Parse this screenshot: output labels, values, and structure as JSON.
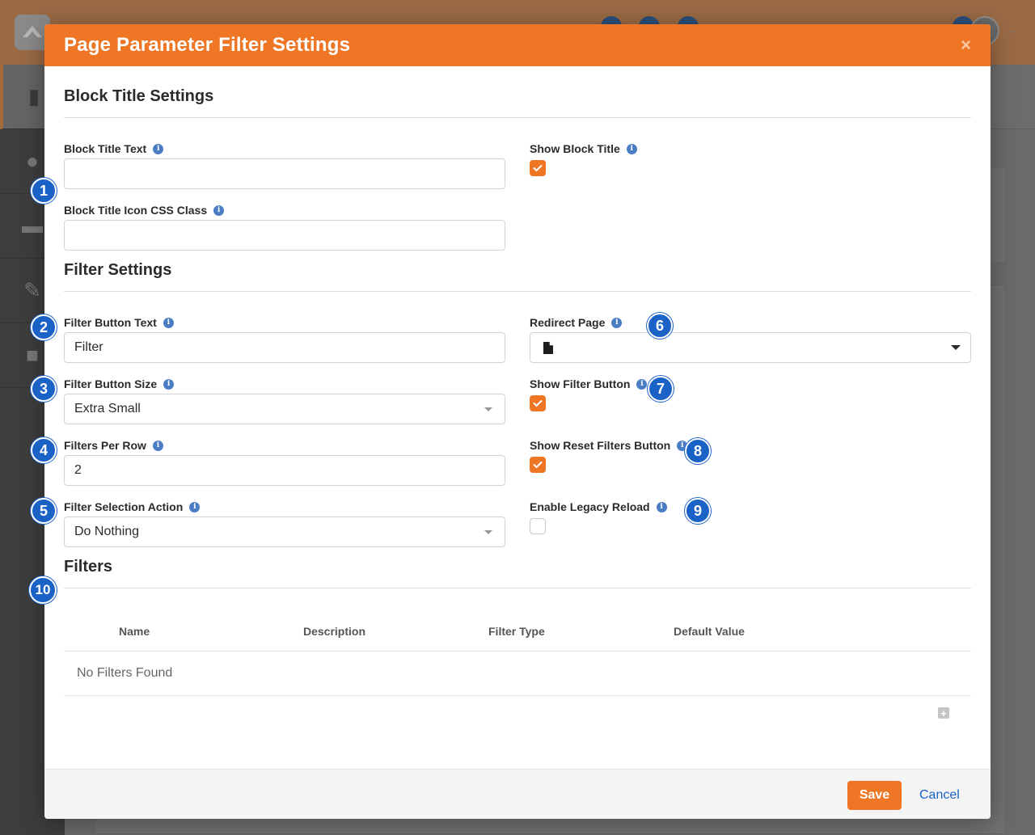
{
  "modal": {
    "title": "Page Parameter Filter Settings",
    "close_glyph": "×"
  },
  "block_title_section": {
    "heading": "Block Title Settings",
    "block_title_text": {
      "label": "Block Title Text",
      "value": ""
    },
    "block_title_icon_css_class": {
      "label": "Block Title Icon CSS Class",
      "value": ""
    },
    "show_block_title": {
      "label": "Show Block Title",
      "checked": true
    }
  },
  "filter_settings_section": {
    "heading": "Filter Settings",
    "filter_button_text": {
      "label": "Filter Button Text",
      "value": "Filter"
    },
    "filter_button_size": {
      "label": "Filter Button Size",
      "value": "Extra Small"
    },
    "filters_per_row": {
      "label": "Filters Per Row",
      "value": "2"
    },
    "filter_selection_action": {
      "label": "Filter Selection Action",
      "value": "Do Nothing"
    },
    "redirect_page": {
      "label": "Redirect Page",
      "value": ""
    },
    "show_filter_button": {
      "label": "Show Filter Button",
      "checked": true
    },
    "show_reset_filters_button": {
      "label": "Show Reset Filters Button",
      "checked": true
    },
    "enable_legacy_reload": {
      "label": "Enable Legacy Reload",
      "checked": false
    }
  },
  "filters_section": {
    "heading": "Filters",
    "columns": [
      "Name",
      "Description",
      "Filter Type",
      "Default Value"
    ],
    "empty_text": "No Filters Found"
  },
  "footer": {
    "save_label": "Save",
    "cancel_label": "Cancel"
  },
  "callouts": [
    "1",
    "2",
    "3",
    "4",
    "5",
    "6",
    "7",
    "8",
    "9",
    "10"
  ],
  "colors": {
    "accent": "#ee7625",
    "callout": "#1b62c6",
    "info": "#4a7dc4"
  },
  "icons": {
    "info": "info-icon",
    "checkmark": "checkmark-icon",
    "page": "file-icon",
    "add": "plus-icon",
    "close": "close-icon"
  }
}
